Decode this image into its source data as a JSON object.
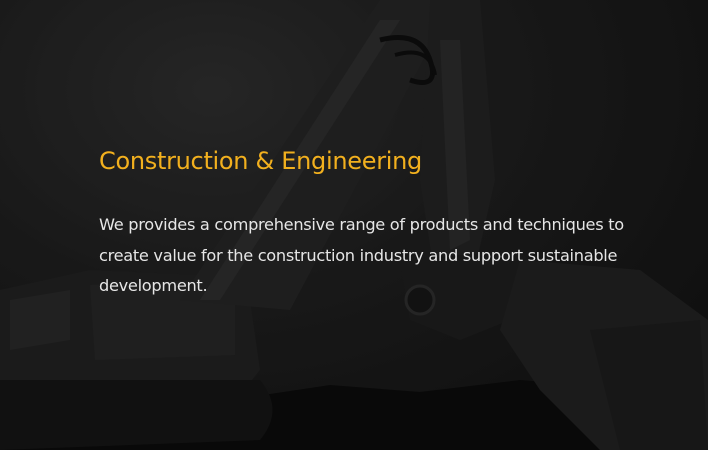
{
  "hero": {
    "title": "Construction & Engineering",
    "description": "We provides a comprehensive range of products and techniques to create value for the construction industry and support sustainable development.",
    "title_color": "#f2b01e",
    "text_color": "#e6e6e6",
    "background_image": "excavator-photo"
  }
}
